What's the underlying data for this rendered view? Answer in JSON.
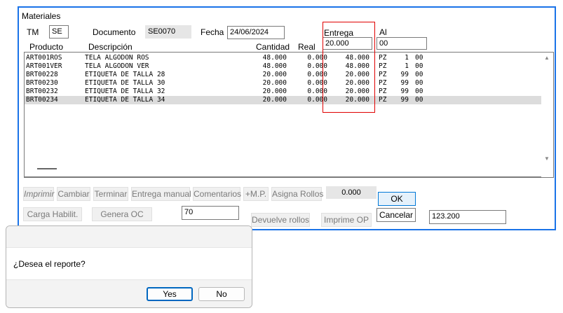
{
  "window": {
    "title": "Materiales",
    "tm_label": "TM",
    "tm_value": "SE",
    "documento_label": "Documento",
    "documento_value": "SE0070",
    "fecha_label": "Fecha",
    "fecha_value": "24/06/2024",
    "entrega_label": "Entrega",
    "entrega_value": "20.000",
    "al_label": "Al",
    "al_value": "00"
  },
  "table": {
    "headers": {
      "producto": "Producto",
      "descripcion": "Descripción",
      "cantidad": "Cantidad",
      "real": "Real"
    },
    "rows": [
      {
        "producto": "ART001ROS",
        "descripcion": "TELA ALGODON ROS",
        "cantidad": "48.000",
        "real": "0.000",
        "entrega": "48.000",
        "unidad": "PZ",
        "n1": "1",
        "n2": "00"
      },
      {
        "producto": "ART001VER",
        "descripcion": "TELA ALGODON VER",
        "cantidad": "48.000",
        "real": "0.000",
        "entrega": "48.000",
        "unidad": "PZ",
        "n1": "1",
        "n2": "00"
      },
      {
        "producto": "BRT00228",
        "descripcion": "ETIQUETA DE TALLA 28",
        "cantidad": "20.000",
        "real": "0.000",
        "entrega": "20.000",
        "unidad": "PZ",
        "n1": "99",
        "n2": "00"
      },
      {
        "producto": "BRT00230",
        "descripcion": "ETIQUETA DE TALLA 30",
        "cantidad": "20.000",
        "real": "0.000",
        "entrega": "20.000",
        "unidad": "PZ",
        "n1": "99",
        "n2": "00"
      },
      {
        "producto": "BRT00232",
        "descripcion": "ETIQUETA DE TALLA 32",
        "cantidad": "20.000",
        "real": "0.000",
        "entrega": "20.000",
        "unidad": "PZ",
        "n1": "99",
        "n2": "00"
      },
      {
        "producto": "BRT00234",
        "descripcion": "ETIQUETA DE TALLA 34",
        "cantidad": "20.000",
        "real": "0.000",
        "entrega": "20.000",
        "unidad": "PZ",
        "n1": "99",
        "n2": "00"
      }
    ],
    "selected_index": 5
  },
  "buttons": {
    "imprimir": "Imprimir",
    "cambiar": "Cambiar",
    "terminar": "Terminar",
    "entrega_manual": "Entrega manual",
    "comentarios": "Comentarios",
    "mp": "+M.P.",
    "asigna_rollos": "Asigna Rollos",
    "ok": "OK",
    "cancelar": "Cancelar",
    "carga_habilit": "Carga Habilit.",
    "genera_oc": "Genera OC",
    "devuelve_rollos": "Devuelve rollos",
    "imprime_op": "Imprime OP"
  },
  "values": {
    "asigna_value": "0.000",
    "field_70": "70",
    "total": "123.200"
  },
  "dialog": {
    "message": "¿Desea el reporte?",
    "yes": "Yes",
    "no": "No"
  },
  "colors": {
    "window_border": "#1a73e8",
    "highlight_box": "#e00000",
    "selected_row": "#dcdcdc",
    "default_button": "#0067c0"
  }
}
